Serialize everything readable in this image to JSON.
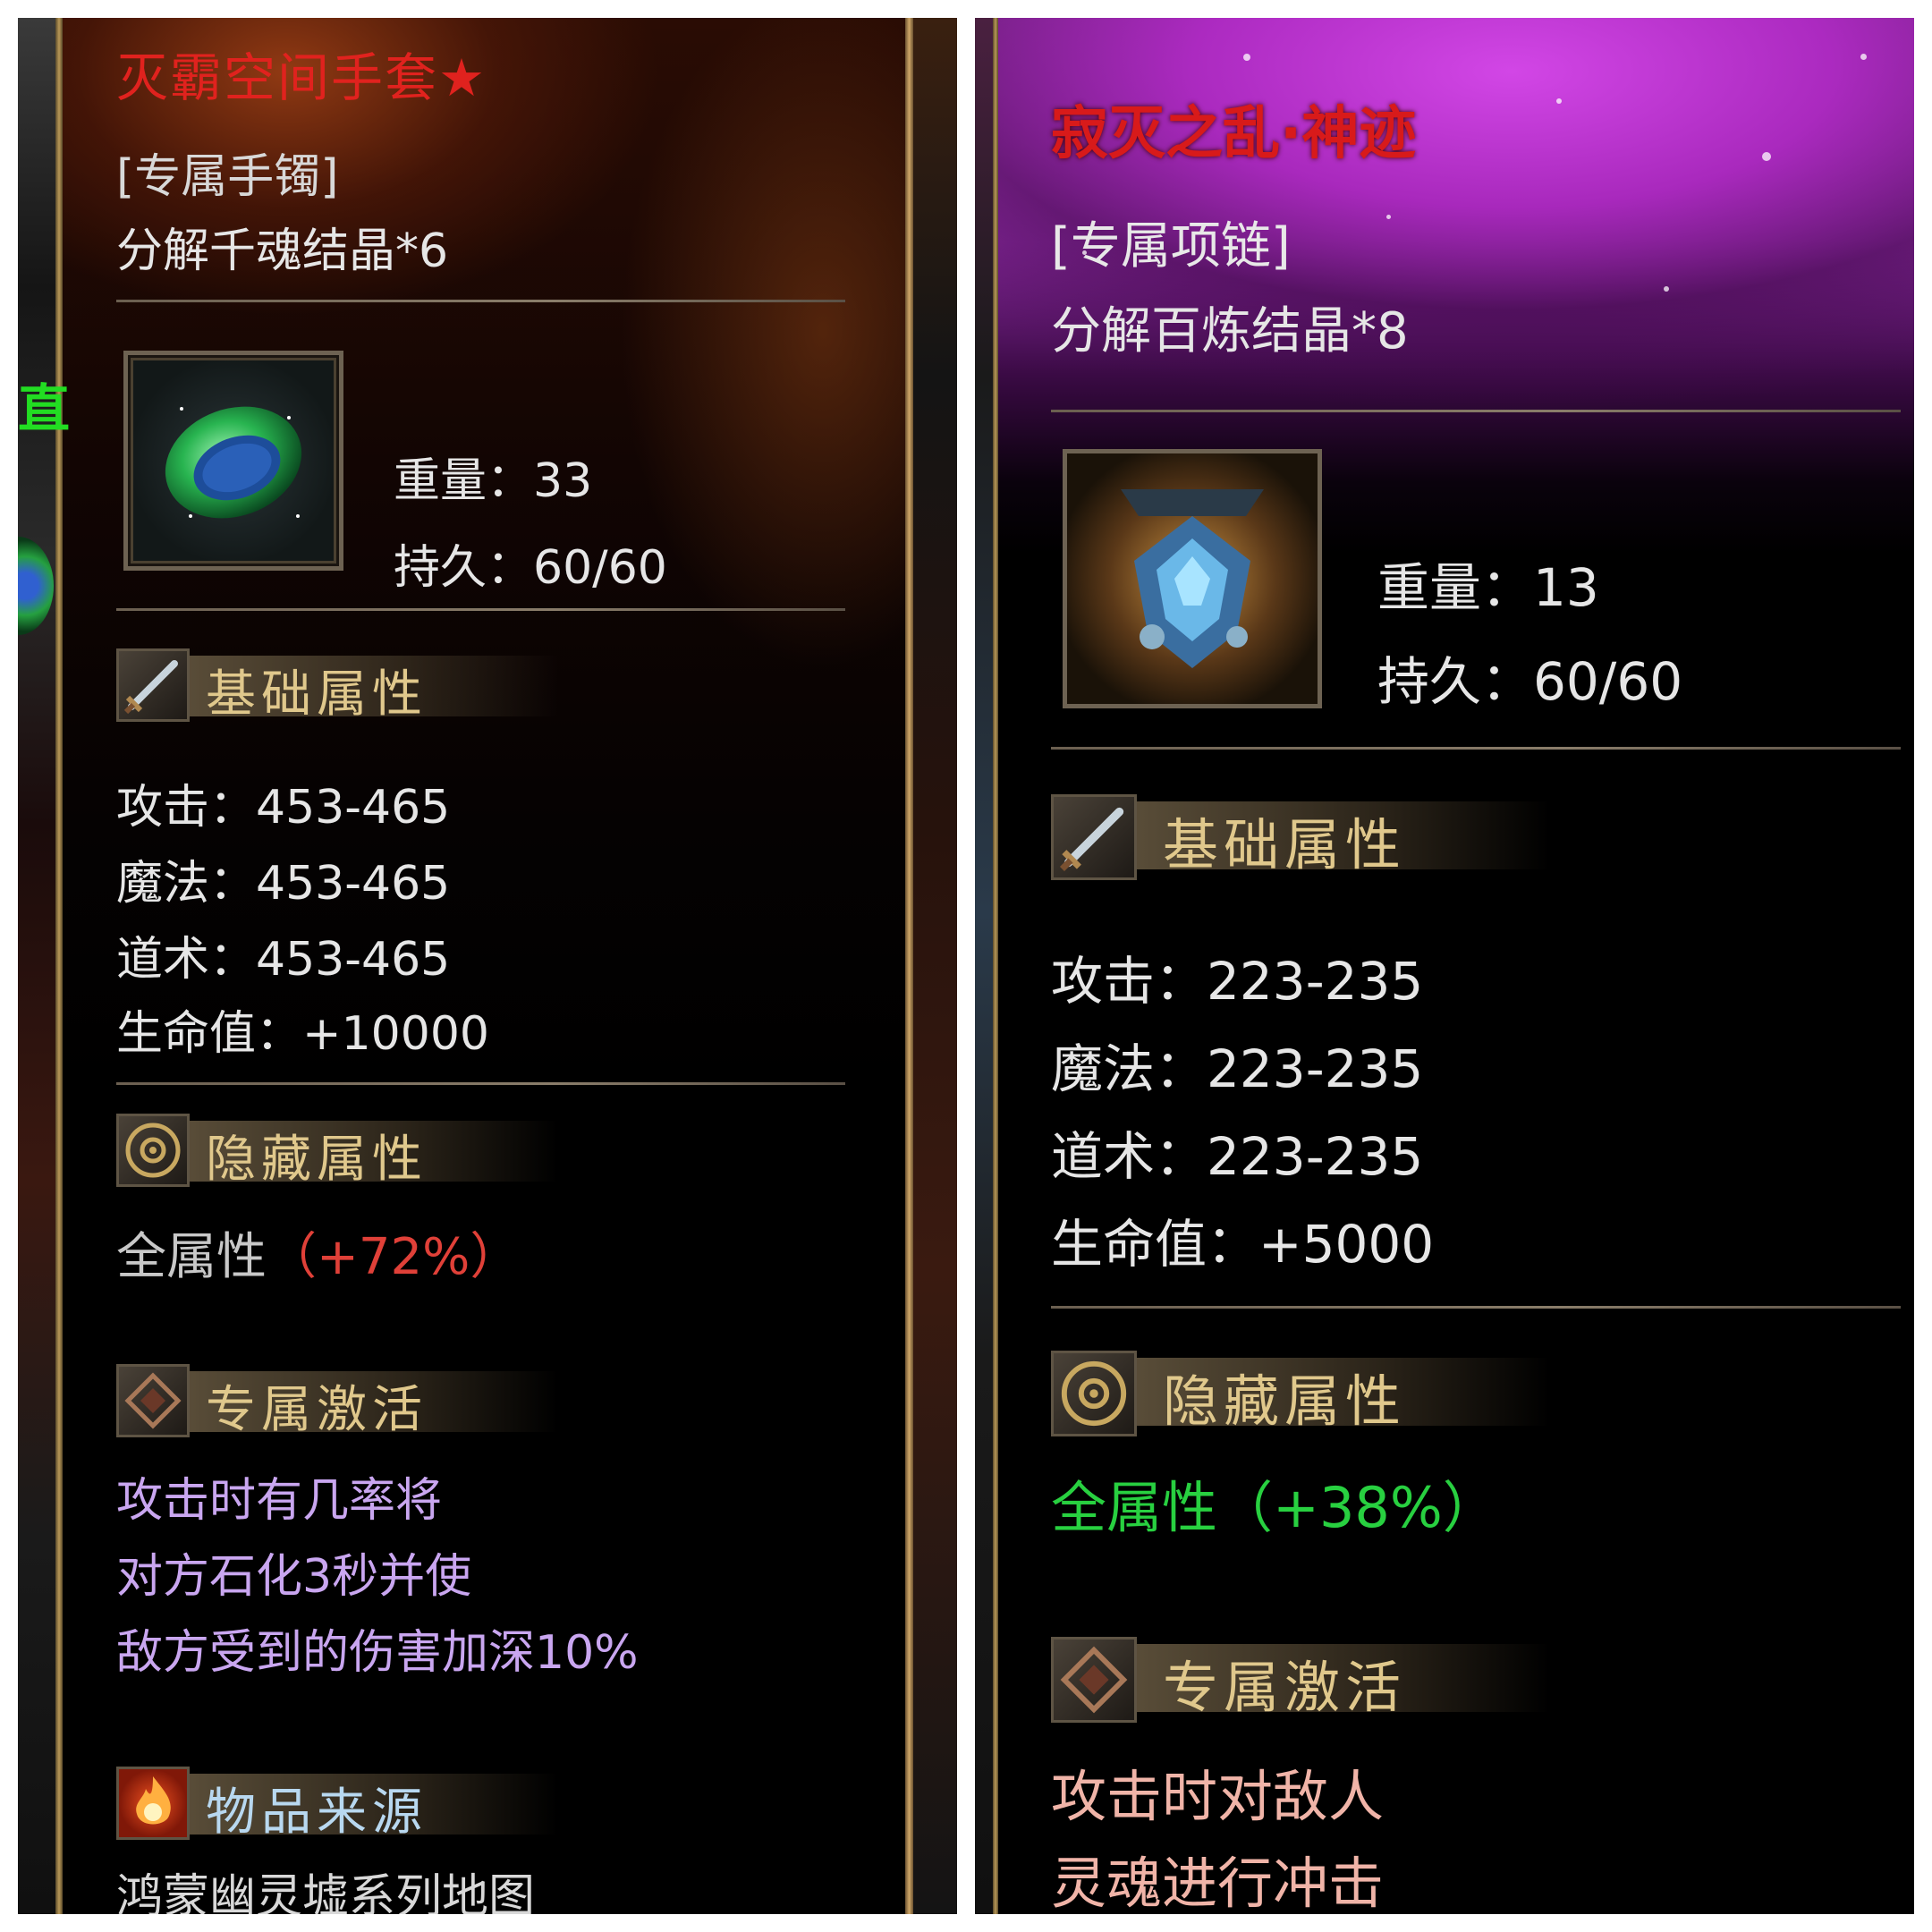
{
  "left": {
    "item_name": "灭霸空间手套★",
    "item_type": "[专属手镯]",
    "decompose": "分解千魂结晶*6",
    "weight": "重量：33",
    "durability": "持久：60/60",
    "base_header": "基础属性",
    "stats": [
      "攻击：453-465",
      "魔法：453-465",
      "道术：453-465",
      "生命值：+10000"
    ],
    "hidden_header": "隐藏属性",
    "hidden_label": "全属性",
    "hidden_value": "（+72%）",
    "exclusive_header": "专属激活",
    "exclusive_lines": [
      "攻击时有几率将",
      "对方石化3秒并使",
      "敌方受到的伤害加深10%"
    ],
    "source_header": "物品来源",
    "source_text": "鸿蒙幽灵墟系列地图",
    "edge_text": "直"
  },
  "right": {
    "item_name": "寂灭之乱·神迹",
    "item_type": "[专属项链]",
    "decompose": "分解百炼结晶*8",
    "weight": "重量：13",
    "durability": "持久：60/60",
    "base_header": "基础属性",
    "stats": [
      "攻击：223-235",
      "魔法：223-235",
      "道术：223-235",
      "生命值：+5000"
    ],
    "hidden_header": "隐藏属性",
    "hidden_text": "全属性（+38%）",
    "exclusive_header": "专属激活",
    "exclusive_lines": [
      "攻击时对敌人",
      "灵魂进行冲击"
    ]
  },
  "colors": {
    "left_title": "#e0221e",
    "right_title": "#d81a1a",
    "hidden_left_value": "#e04038",
    "hidden_right": "#28d040",
    "left_exclusive": "#c9a6f0",
    "right_exclusive": "#f0b4a8",
    "section_title": "#e0c88c"
  },
  "icons": {
    "item_left": "jade-bracelet-icon",
    "item_right": "crystal-necklace-icon",
    "base": "sword-icon",
    "hidden": "gear-icon",
    "exclusive": "diamond-icon",
    "source": "flame-icon"
  }
}
